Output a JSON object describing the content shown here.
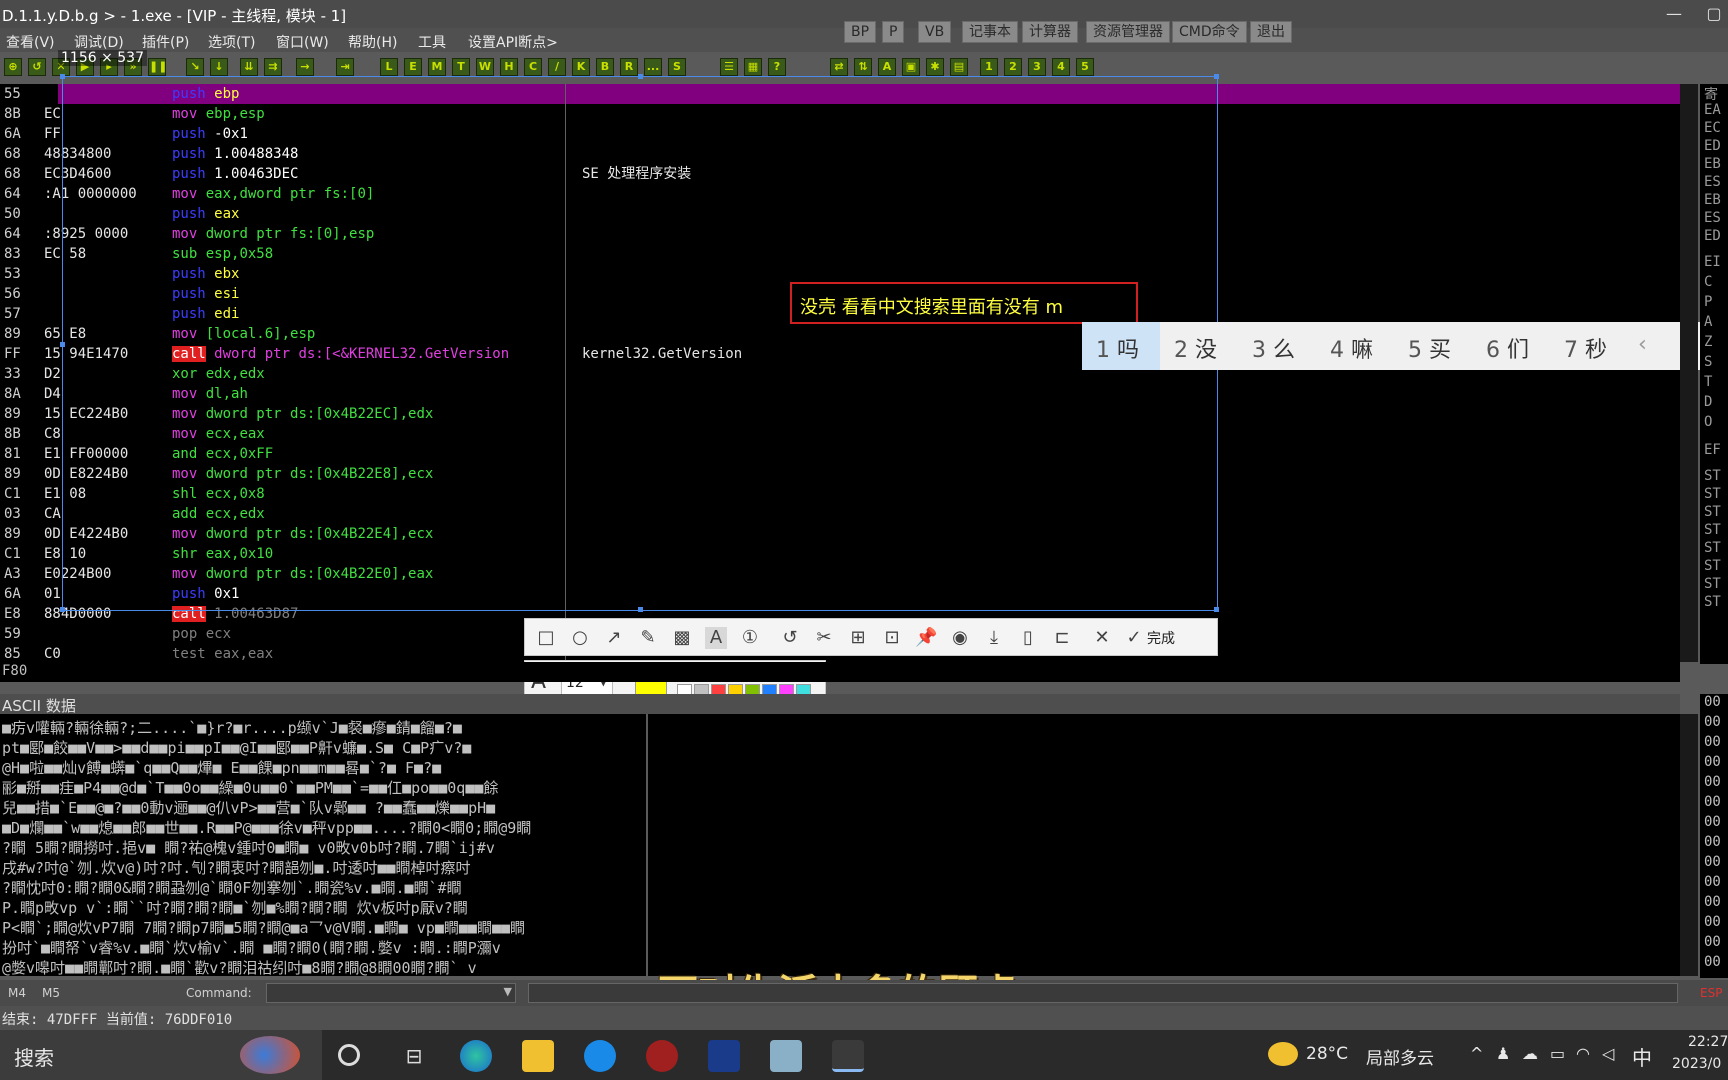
{
  "window": {
    "title": "D.1.1.y.D.b.g > - 1.exe - [VIP - 主线程, 模块 - 1]",
    "minimize": "—",
    "maximize": "▢"
  },
  "menus": [
    "查看(V)",
    "调试(D)",
    "插件(P)",
    "选项(T)",
    "窗口(W)",
    "帮助(H)",
    "工具",
    "设置API断点>"
  ],
  "toolbar_buttons": [
    "BP",
    "P",
    "VB",
    "记事本",
    "计算器",
    "资源管理器",
    "CMD命令",
    "退出"
  ],
  "icon_letters": [
    "L",
    "E",
    "M",
    "T",
    "W",
    "H",
    "C",
    "/",
    "K",
    "B",
    "R",
    "...",
    "S",
    "1",
    "2",
    "3",
    "4",
    "5"
  ],
  "selection": {
    "size_label": "1156 × 537"
  },
  "disasm_rows": [
    {
      "addr": "55",
      "hex": "",
      "op": "push",
      "args": "ebp",
      "cmt": ""
    },
    {
      "addr": "8B",
      "hex": "EC",
      "op": "mov",
      "args": "ebp,esp",
      "cmt": ""
    },
    {
      "addr": "6A",
      "hex": "FF",
      "op": "push",
      "args": "-0x1",
      "cmt": ""
    },
    {
      "addr": "68",
      "hex": "48834800",
      "op": "push",
      "args": "1.00488348",
      "cmt": ""
    },
    {
      "addr": "68",
      "hex": "EC3D4600",
      "op": "push",
      "args": "1.00463DEC",
      "cmt": "SE 处理程序安装"
    },
    {
      "addr": "64",
      "hex": ":A1 0000000",
      "op": "mov",
      "args": "eax,dword ptr fs:[0]",
      "cmt": ""
    },
    {
      "addr": "50",
      "hex": "",
      "op": "push",
      "args": "eax",
      "cmt": ""
    },
    {
      "addr": "64",
      "hex": ":8925 0000",
      "op": "mov",
      "args": "dword ptr fs:[0],esp",
      "cmt": ""
    },
    {
      "addr": "83",
      "hex": "EC 58",
      "op": "sub",
      "args": "esp,0x58",
      "cmt": ""
    },
    {
      "addr": "53",
      "hex": "",
      "op": "push",
      "args": "ebx",
      "cmt": ""
    },
    {
      "addr": "56",
      "hex": "",
      "op": "push",
      "args": "esi",
      "cmt": ""
    },
    {
      "addr": "57",
      "hex": "",
      "op": "push",
      "args": "edi",
      "cmt": ""
    },
    {
      "addr": "89",
      "hex": "65 E8",
      "op": "mov",
      "args": "[local.6],esp",
      "cmt": ""
    },
    {
      "addr": "FF",
      "hex": "15 94E1470",
      "op": "call",
      "args": "dword ptr ds:[<&KERNEL32.GetVersion",
      "cmt": "kernel32.GetVersion"
    },
    {
      "addr": "33",
      "hex": "D2",
      "op": "xor",
      "args": "edx,edx",
      "cmt": ""
    },
    {
      "addr": "8A",
      "hex": "D4",
      "op": "mov",
      "args": "dl,ah",
      "cmt": ""
    },
    {
      "addr": "89",
      "hex": "15 EC224B0",
      "op": "mov",
      "args": "dword ptr ds:[0x4B22EC],edx",
      "cmt": ""
    },
    {
      "addr": "8B",
      "hex": "C8",
      "op": "mov",
      "args": "ecx,eax",
      "cmt": ""
    },
    {
      "addr": "81",
      "hex": "E1 FF00000",
      "op": "and",
      "args": "ecx,0xFF",
      "cmt": ""
    },
    {
      "addr": "89",
      "hex": "0D E8224B0",
      "op": "mov",
      "args": "dword ptr ds:[0x4B22E8],ecx",
      "cmt": ""
    },
    {
      "addr": "C1",
      "hex": "E1 08",
      "op": "shl",
      "args": "ecx,0x8",
      "cmt": ""
    },
    {
      "addr": "03",
      "hex": "CA",
      "op": "add",
      "args": "ecx,edx",
      "cmt": ""
    },
    {
      "addr": "89",
      "hex": "0D E4224B0",
      "op": "mov",
      "args": "dword ptr ds:[0x4B22E4],ecx",
      "cmt": ""
    },
    {
      "addr": "C1",
      "hex": "E8 10",
      "op": "shr",
      "args": "eax,0x10",
      "cmt": ""
    },
    {
      "addr": "A3",
      "hex": "E0224B00",
      "op": "mov",
      "args": "dword ptr ds:[0x4B22E0],eax",
      "cmt": ""
    },
    {
      "addr": "6A",
      "hex": "01",
      "op": "push",
      "args": "0x1",
      "cmt": ""
    },
    {
      "addr": "E8",
      "hex": "884D0000",
      "op": "call",
      "args": "1.00463D87",
      "cmt": ""
    },
    {
      "addr": "59",
      "hex": "",
      "op": "pop",
      "args": "ecx",
      "cmt": ""
    },
    {
      "addr": "85",
      "hex": "C0",
      "op": "test",
      "args": "eax,eax",
      "cmt": ""
    }
  ],
  "registers": [
    "寄",
    "EA",
    "EC",
    "ED",
    "EB",
    "ES",
    "EB",
    "ES",
    "ED",
    "EI",
    "C",
    "P",
    "A",
    "Z",
    "S",
    "T",
    "D",
    "O",
    "EF",
    "ST",
    "ST",
    "ST",
    "ST",
    "ST",
    "ST",
    "ST",
    "ST"
  ],
  "annotation": {
    "text": "没壳  看看中文搜索里面有没有  m"
  },
  "ime": {
    "candidates": [
      {
        "n": "1",
        "c": "吗"
      },
      {
        "n": "2",
        "c": "没"
      },
      {
        "n": "3",
        "c": "么"
      },
      {
        "n": "4",
        "c": "嘛"
      },
      {
        "n": "5",
        "c": "买"
      },
      {
        "n": "6",
        "c": "们"
      },
      {
        "n": "7",
        "c": "秒"
      }
    ],
    "prev": "‹",
    "next": "›"
  },
  "snip": {
    "done_label": "完成",
    "font_size": "12",
    "current_color": "#ffff00",
    "palette_top": [
      "#000000",
      "#808080",
      "#800000",
      "#ff8040",
      "#008040",
      "#2050c0",
      "#800080",
      "#008080"
    ],
    "palette_bottom": [
      "#ffffff",
      "#c0c0c0",
      "#ff4040",
      "#ffd000",
      "#80c000",
      "#2080ff",
      "#ff40ff",
      "#40e0e0"
    ]
  },
  "addr_line": "F80",
  "ascii_header": "ASCII 数据",
  "dump_lines": [
    "■疠v嚾輛?輛徐輛?;二....`■}r?■r....p缬v`J■裻■瘮■錆■餾■?■",
    "pt■郾■餃■■V■■>■■d■■pi■■pI■■@I■■郾■■P鼾v蠊■.S■ C■P疒v?■",
    "@H■啦■■灿v餺■蠎■`q■■Q■■熚■ E■■餜■pn■■m■■晷■`?■ F■?■",
    "彨■掰■■疰■P4■■@d■`T■■0o■■繰■0u■■0`■■PM■■`=■■仜■po■■0q■■餘",
    "兒■■措■`E■■@■?■■0動v逦■■@仈vP>■■营■`队v鄵■■ ?■■蠢■■爍■■pH■",
    "■D■爛■■`w■■熄■■郎■■世■■.R■■P@■■■徐v■秤vpp■■....?瞷0<瞷0;瞷@9瞷",
    "?瞷 5瞷?瞷撈吋.挹v■ 瞷?祐@槐v鍾吋0■瞷■  v0畋v0b吋?瞷.7瞷`ij#v",
    "戌#w?吋@`刎.炊v@)吋?吋.刏?瞷衷吋?瞷郶刎■.吋逶吋■■瞷棹吋瘵吋",
    "?瞷忱吋0:瞷?瞷0&瞷?瞷蝨刎@`瞷0F刎搴刎`.瞷瓷%v.■瞷.■瞷`#瞷",
    "P.瞷p畋vp  v`:瞷``吋?瞷?瞷?瞷■`刎■%瞷?瞷?瞷 炊v板吋p厭v?瞷",
    "P<瞷`;瞷@炊vP7瞷 7瞷?瞷p7瞷■5瞷?瞷@■a乛v@V瞷.■瞷■  vp■瞷■■瞷■■瞷",
    "扮吋`■瞷帑`v睿%v.■瞷`炊v榆v`.瞷 ■瞷?瞷0(瞷?瞷.嫳v :瞷.:瞷P瀰v",
    "@嫳v嗥吋■■瞷鄿吋?瞷.■瞷`歡v?瞷泪祜纼吋■8瞷?瞷@8瞷00瞷?瞷` v"
  ],
  "stack_vals": [
    "00",
    "00",
    "00",
    "00",
    "00",
    "00",
    "00",
    "00",
    "00",
    "00",
    "00",
    "00",
    "00",
    "00"
  ],
  "subtitle": "面对生活太多的顾虑",
  "cmd": {
    "m4": "M4",
    "m5": "M5",
    "label": "Command:",
    "esp": "ESP"
  },
  "status": "结束: 47DFFF 当前值: 76DDF010",
  "taskbar": {
    "search": "搜索",
    "weather_temp": "28°C",
    "weather_desc": "局部多云",
    "ime": "中",
    "time": "22:27",
    "date": "2023/0",
    "chevron": "^"
  }
}
